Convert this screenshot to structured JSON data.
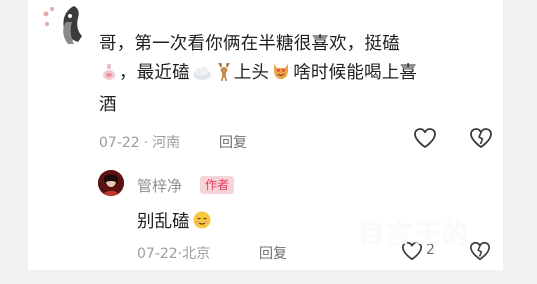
{
  "comment": {
    "line1": "哥，第一次看你俩在半糖很喜欢，挺磕",
    "line2_a": "，最近磕",
    "line2_b": "上头",
    "line2_c": "啥时候能喝上喜",
    "line3": "酒",
    "date": "07-22",
    "separator": "·",
    "location": "河南",
    "reply_label": "回复"
  },
  "reply": {
    "author": "管梓净",
    "badge": "作者",
    "text": "别乱磕",
    "date": "07-22",
    "separator": "·",
    "location": "北京",
    "reply_label": "回复",
    "like_count": "2"
  },
  "watermark": "目言王的",
  "icons": {
    "like": "heart-outline-icon",
    "dislike": "broken-heart-icon",
    "emoji_bottle": "wine-bottle-emoji",
    "emoji_cloud": "cloud-emoji",
    "emoji_deer": "deer-emoji",
    "emoji_cat": "heart-eyes-cat-emoji",
    "emoji_face": "sleepy-face-emoji"
  },
  "colors": {
    "badge_bg": "#f6d4d9",
    "badge_text": "#e23b58",
    "meta": "#9d9d9d"
  }
}
